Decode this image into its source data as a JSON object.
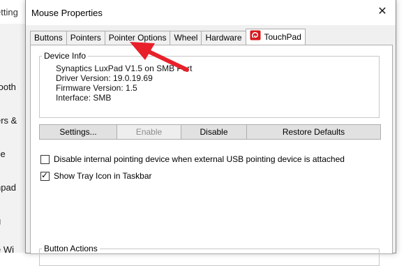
{
  "background_window": {
    "title": "etting",
    "items": [
      "tooth",
      "ers &",
      "se",
      "hpad",
      "g",
      "e Wi"
    ]
  },
  "dialog": {
    "title": "Mouse Properties",
    "close_label": "✕"
  },
  "tabs": [
    {
      "label": "Buttons"
    },
    {
      "label": "Pointers"
    },
    {
      "label": "Pointer Options"
    },
    {
      "label": "Wheel"
    },
    {
      "label": "Hardware"
    },
    {
      "label": "TouchPad",
      "active": true,
      "icon": "synaptics-icon"
    }
  ],
  "device_info": {
    "legend": "Device Info",
    "lines": [
      "Synaptics LuxPad V1.5 on SMB Port",
      "Driver Version: 19.0.19.69",
      "Firmware Version: 1.5",
      "Interface: SMB"
    ]
  },
  "buttons": {
    "settings": "Settings...",
    "enable": "Enable",
    "disable": "Disable",
    "restore": "Restore Defaults"
  },
  "options": {
    "disable_internal": {
      "label": "Disable internal pointing device when external USB pointing device is attached",
      "checked": false
    },
    "show_tray": {
      "label": "Show Tray Icon in Taskbar",
      "checked": true
    }
  },
  "button_actions": {
    "legend": "Button Actions"
  },
  "colors": {
    "arrow": "#e8202a",
    "synaptics_red": "#d7191c"
  }
}
